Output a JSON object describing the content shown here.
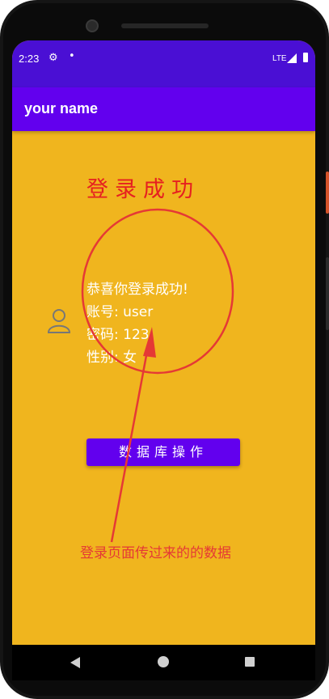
{
  "status_bar": {
    "time": "2:23",
    "network": "LTE",
    "icons": [
      "settings-gear-icon",
      "notification-dot-icon",
      "signal-icon",
      "battery-icon"
    ]
  },
  "app_bar": {
    "title": "your name"
  },
  "content": {
    "heading": "登录成功",
    "greeting": "恭喜你登录成功!",
    "account": "账号: user",
    "password": "密码: 123",
    "gender": "性别: 女",
    "db_button": "数据库操作"
  },
  "annotation": {
    "text": "登录页面传过来的的数据",
    "color": "#e53935"
  },
  "colors": {
    "background": "#f0b51e",
    "status_bar": "#4a0fd4",
    "app_bar": "#6200ee",
    "heading": "#e62020"
  },
  "nav_bar": {
    "icons": [
      "back-icon",
      "home-icon",
      "recents-icon"
    ]
  }
}
